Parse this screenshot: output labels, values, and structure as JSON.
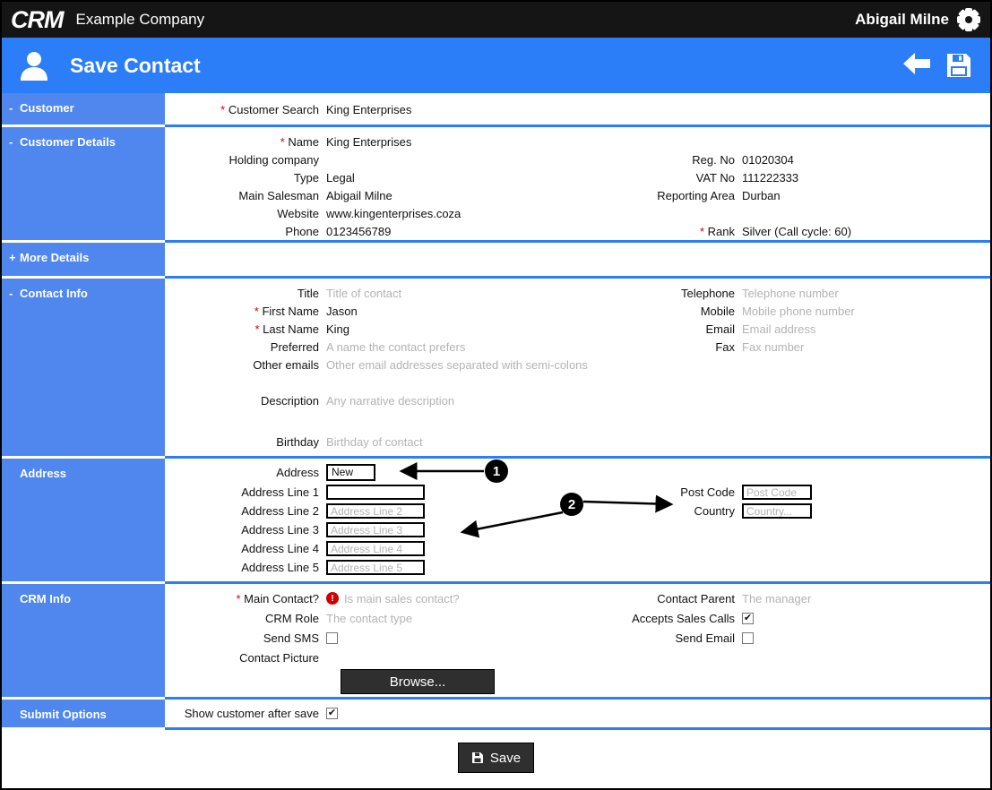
{
  "topbar": {
    "logo": "CRM",
    "company": "Example Company",
    "user": "Abigail Milne"
  },
  "header": {
    "title": "Save Contact"
  },
  "sidebar": {
    "items": [
      {
        "label": "Customer",
        "prefix": "-"
      },
      {
        "label": "Customer Details",
        "prefix": "-"
      },
      {
        "label": "More Details",
        "prefix": "+"
      },
      {
        "label": "Contact Info",
        "prefix": "-"
      },
      {
        "label": "Address",
        "prefix": ""
      },
      {
        "label": "CRM Info",
        "prefix": ""
      },
      {
        "label": "Submit Options",
        "prefix": ""
      }
    ]
  },
  "customer": {
    "search": {
      "label": "Customer Search",
      "value": "King Enterprises"
    }
  },
  "customer_details": {
    "name": {
      "label": "Name",
      "value": "King Enterprises"
    },
    "holding": {
      "label": "Holding company",
      "value": ""
    },
    "type": {
      "label": "Type",
      "value": "Legal"
    },
    "salesman": {
      "label": "Main Salesman",
      "value": "Abigail Milne"
    },
    "website": {
      "label": "Website",
      "value": "www.kingenterprises.coza"
    },
    "phone": {
      "label": "Phone",
      "value": "0123456789"
    },
    "regno": {
      "label": "Reg. No",
      "value": "01020304"
    },
    "vatno": {
      "label": "VAT No",
      "value": "111222333"
    },
    "reporting": {
      "label": "Reporting Area",
      "value": "Durban"
    },
    "rank": {
      "label": "Rank",
      "value": "Silver (Call cycle: 60)"
    }
  },
  "contact_info": {
    "title": {
      "label": "Title",
      "placeholder": "Title of contact"
    },
    "first_name": {
      "label": "First Name",
      "value": "Jason"
    },
    "last_name": {
      "label": "Last Name",
      "value": "King"
    },
    "preferred": {
      "label": "Preferred",
      "placeholder": "A name the contact prefers"
    },
    "other_emails": {
      "label": "Other emails",
      "placeholder": "Other email addresses separated with semi-colons"
    },
    "description": {
      "label": "Description",
      "placeholder": "Any narrative description"
    },
    "birthday": {
      "label": "Birthday",
      "placeholder": "Birthday of contact"
    },
    "telephone": {
      "label": "Telephone",
      "placeholder": "Telephone number"
    },
    "mobile": {
      "label": "Mobile",
      "placeholder": "Mobile phone number"
    },
    "email": {
      "label": "Email",
      "placeholder": "Email address"
    },
    "fax": {
      "label": "Fax",
      "placeholder": "Fax number"
    }
  },
  "address": {
    "selector": {
      "label": "Address",
      "value": "New"
    },
    "line1": {
      "label": "Address Line 1",
      "placeholder": ""
    },
    "line2": {
      "label": "Address Line 2",
      "placeholder": "Address Line 2"
    },
    "line3": {
      "label": "Address Line 3",
      "placeholder": "Address Line 3"
    },
    "line4": {
      "label": "Address Line 4",
      "placeholder": "Address Line 4"
    },
    "line5": {
      "label": "Address Line 5",
      "placeholder": "Address Line 5"
    },
    "post_code": {
      "label": "Post Code",
      "placeholder": "Post Code"
    },
    "country": {
      "label": "Country",
      "placeholder": "Country..."
    }
  },
  "crm_info": {
    "main_contact": {
      "label": "Main Contact?",
      "placeholder": "Is main sales contact?"
    },
    "crm_role": {
      "label": "CRM Role",
      "placeholder": "The contact type"
    },
    "send_sms": {
      "label": "Send SMS",
      "checked": false
    },
    "contact_picture": {
      "label": "Contact Picture",
      "button": "Browse..."
    },
    "contact_parent": {
      "label": "Contact Parent",
      "placeholder": "The manager"
    },
    "accepts_sales_calls": {
      "label": "Accepts Sales Calls",
      "checked": true
    },
    "send_email": {
      "label": "Send Email",
      "checked": false
    }
  },
  "submit_options": {
    "show_customer": {
      "label": "Show customer after save",
      "checked": true
    }
  },
  "footer": {
    "save_label": "Save"
  },
  "annotations": {
    "badge1": "1",
    "badge2": "2"
  },
  "colors": {
    "header_blue": "#2b7df8",
    "sidebar_blue": "#4f87ef",
    "dark_button": "#2f2f2f",
    "required_red": "#d40000"
  }
}
